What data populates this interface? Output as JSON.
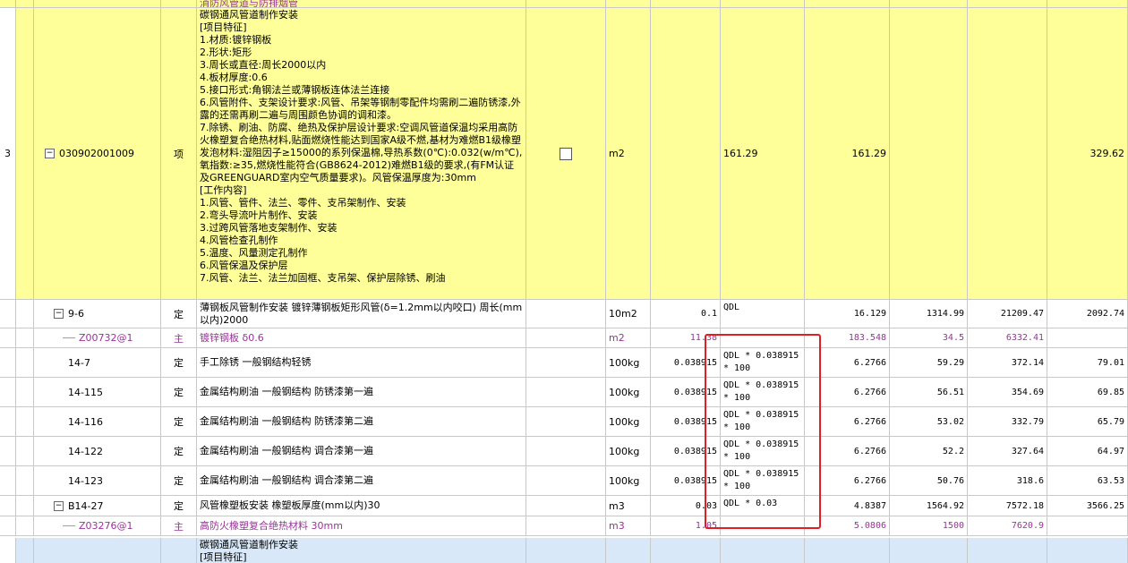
{
  "top_partial_text": "消防风管道与防排烟管",
  "main_item": {
    "seq": "3",
    "code": "030902001009",
    "type": "项",
    "description": "碳钢通风管道制作安装\n[项目特征]\n1.材质:镀锌钢板\n2.形状:矩形\n3.周长或直径:周长2000以内\n4.板材厚度:0.6\n5.接口形式:角钢法兰或薄钢板连体法兰连接\n6.风管附件、支架设计要求:风管、吊架等钢制零配件均需刷二遍防锈漆,外露的还需再刷二遍与周围颜色协调的调和漆。\n7.除锈、刷油、防腐、绝热及保护层设计要求:空调风管道保温均采用高防火橡塑复合绝热材料,贴面燃烧性能达到国家A级不燃,基材为难燃B1级橡塑发泡材料:湿阻因子≥15000的系列保温棉,导热系数(0℃):0.032(w/m℃),氧指数:≥35,燃烧性能符合(GB8624-2012)难燃B1级的要求,(有FM认证及GREENGUARD室内空气质量要求)。风管保温厚度为:30mm\n[工作内容]\n1.风管、管件、法兰、零件、支吊架制作、安装\n2.弯头导流叶片制作、安装\n3.过跨风管落地支架制作、安装\n4.风管检查孔制作\n5.温度、风量测定孔制作\n6.风管保温及保护层\n7.风管、法兰、法兰加固框、支吊架、保护层除锈、刷油",
    "unit": "m2",
    "qty_expr": "161.29",
    "qty": "161.29",
    "total": "329.62"
  },
  "rows": [
    {
      "code": "9-6",
      "type": "定",
      "name": "薄钢板风管制作安装 镀锌薄钢板矩形风管(δ=1.2mm以内咬口) 周长(mm以内)2000",
      "unit": "10m2",
      "content": "0.1",
      "expr": "QDL",
      "qty": "16.129",
      "price": "1314.99",
      "amount": "21209.47",
      "extra": "2092.74",
      "tree": "minus",
      "style": "normal"
    },
    {
      "code": "Z00732@1",
      "type": "主",
      "name": "镀锌钢板 δ0.6",
      "unit": "m2",
      "content": "11.38",
      "expr": "",
      "qty": "183.548",
      "price": "34.5",
      "amount": "6332.41",
      "extra": "",
      "tree": "line",
      "style": "purple"
    },
    {
      "code": "14-7",
      "type": "定",
      "name": "手工除锈 一般钢结构轻锈",
      "unit": "100kg",
      "content": "0.038915",
      "expr": "QDL * 0.038915\n* 100",
      "qty": "6.2766",
      "price": "59.29",
      "amount": "372.14",
      "extra": "79.01",
      "tree": "none",
      "style": "normal"
    },
    {
      "code": "14-115",
      "type": "定",
      "name": "金属结构刷油 一般钢结构 防锈漆第一遍",
      "unit": "100kg",
      "content": "0.038915",
      "expr": "QDL * 0.038915\n* 100",
      "qty": "6.2766",
      "price": "56.51",
      "amount": "354.69",
      "extra": "69.85",
      "tree": "none",
      "style": "normal"
    },
    {
      "code": "14-116",
      "type": "定",
      "name": "金属结构刷油 一般钢结构 防锈漆第二遍",
      "unit": "100kg",
      "content": "0.038915",
      "expr": "QDL * 0.038915\n* 100",
      "qty": "6.2766",
      "price": "53.02",
      "amount": "332.79",
      "extra": "65.79",
      "tree": "none",
      "style": "normal"
    },
    {
      "code": "14-122",
      "type": "定",
      "name": "金属结构刷油 一般钢结构 调合漆第一遍",
      "unit": "100kg",
      "content": "0.038915",
      "expr": "QDL * 0.038915\n* 100",
      "qty": "6.2766",
      "price": "52.2",
      "amount": "327.64",
      "extra": "64.97",
      "tree": "none",
      "style": "normal"
    },
    {
      "code": "14-123",
      "type": "定",
      "name": "金属结构刷油 一般钢结构 调合漆第二遍",
      "unit": "100kg",
      "content": "0.038915",
      "expr": "QDL * 0.038915\n* 100",
      "qty": "6.2766",
      "price": "50.76",
      "amount": "318.6",
      "extra": "63.53",
      "tree": "none",
      "style": "normal"
    },
    {
      "code": "B14-27",
      "type": "定",
      "name": "风管橡塑板安装 橡塑板厚度(mm以内)30",
      "unit": "m3",
      "content": "0.03",
      "expr": "QDL * 0.03",
      "qty": "4.8387",
      "price": "1564.92",
      "amount": "7572.18",
      "extra": "3566.25",
      "tree": "minus",
      "style": "normal"
    },
    {
      "code": "Z03276@1",
      "type": "主",
      "name": "高防火橡塑复合绝热材料 30mm",
      "unit": "m3",
      "content": "1.05",
      "expr": "",
      "qty": "5.0806",
      "price": "1500",
      "amount": "7620.9",
      "extra": "",
      "tree": "line",
      "style": "purple"
    }
  ],
  "next_item": {
    "description": "碳钢通风管道制作安装\n[项目特征]"
  }
}
